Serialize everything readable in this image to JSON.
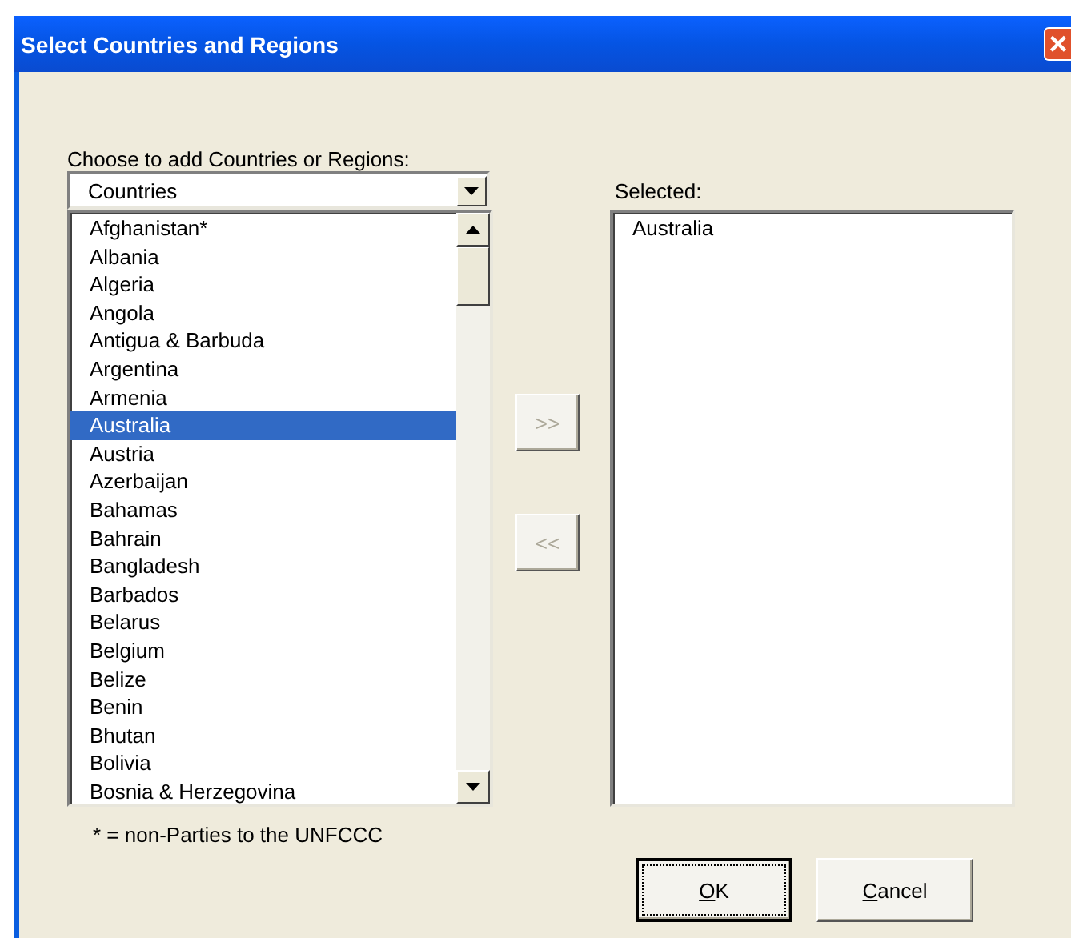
{
  "window": {
    "title": "Select Countries and Regions",
    "close_label": "×"
  },
  "source": {
    "label": "Choose to add Countries or Regions:",
    "dropdown": {
      "value": "Countries"
    },
    "items": [
      {
        "label": "Afghanistan*",
        "selected": false
      },
      {
        "label": "Albania",
        "selected": false
      },
      {
        "label": "Algeria",
        "selected": false
      },
      {
        "label": "Angola",
        "selected": false
      },
      {
        "label": "Antigua & Barbuda",
        "selected": false
      },
      {
        "label": "Argentina",
        "selected": false
      },
      {
        "label": "Armenia",
        "selected": false
      },
      {
        "label": "Australia",
        "selected": true
      },
      {
        "label": "Austria",
        "selected": false
      },
      {
        "label": "Azerbaijan",
        "selected": false
      },
      {
        "label": "Bahamas",
        "selected": false
      },
      {
        "label": "Bahrain",
        "selected": false
      },
      {
        "label": "Bangladesh",
        "selected": false
      },
      {
        "label": "Barbados",
        "selected": false
      },
      {
        "label": "Belarus",
        "selected": false
      },
      {
        "label": "Belgium",
        "selected": false
      },
      {
        "label": "Belize",
        "selected": false
      },
      {
        "label": "Benin",
        "selected": false
      },
      {
        "label": "Bhutan",
        "selected": false
      },
      {
        "label": "Bolivia",
        "selected": false
      },
      {
        "label": "Bosnia & Herzegovina",
        "selected": false
      }
    ]
  },
  "move_buttons": [
    {
      "label": ">>",
      "disabled": true
    },
    {
      "label": "<<",
      "disabled": true
    }
  ],
  "selected_panel": {
    "label": "Selected:",
    "items": [
      {
        "label": "Australia",
        "selected": false
      }
    ]
  },
  "footnote": "* = non-Parties to the UNFCCC",
  "buttons": [
    {
      "label": "OK",
      "default": true
    },
    {
      "label": "Cancel",
      "default": false
    }
  ]
}
